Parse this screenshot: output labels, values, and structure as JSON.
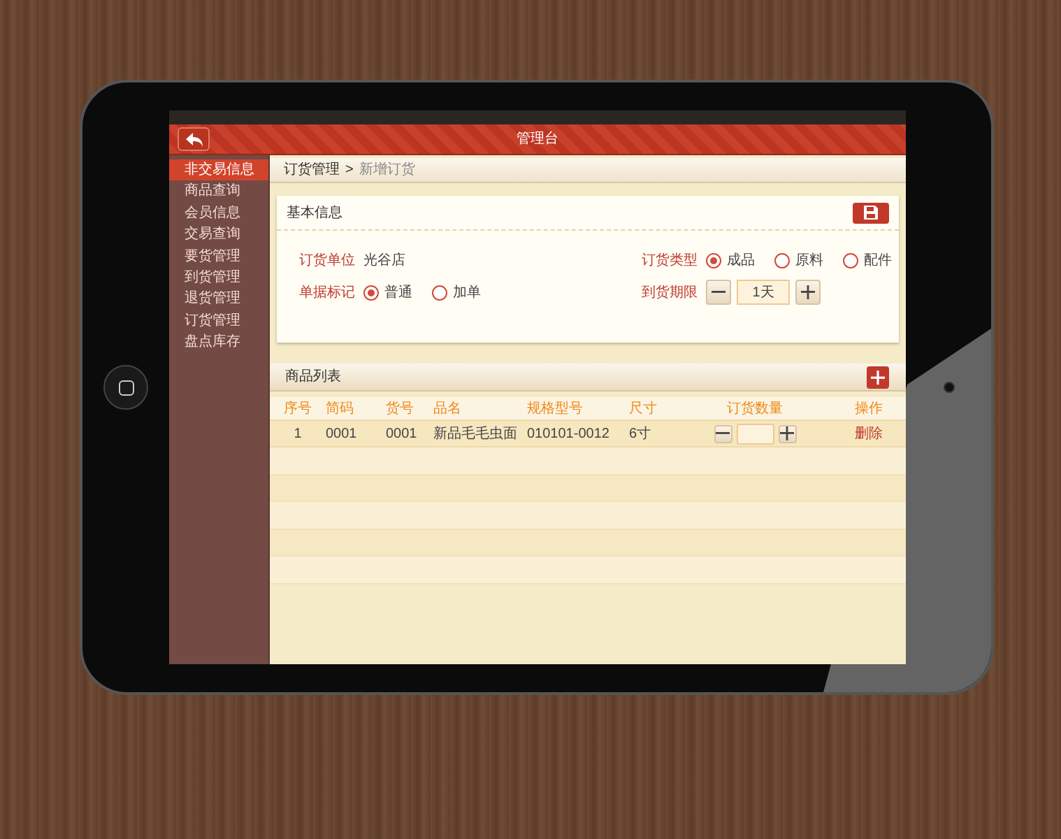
{
  "header": {
    "title": "管理台"
  },
  "sidebar": {
    "items": [
      {
        "label": "非交易信息",
        "selected": true
      },
      {
        "label": "商品查询",
        "selected": false
      },
      {
        "label": "会员信息",
        "selected": false
      },
      {
        "label": "交易查询",
        "selected": false
      },
      {
        "label": "要货管理",
        "selected": false
      },
      {
        "label": "到货管理",
        "selected": false
      },
      {
        "label": "退货管理",
        "selected": false
      },
      {
        "label": "订货管理",
        "selected": false
      },
      {
        "label": "盘点库存",
        "selected": false
      }
    ]
  },
  "breadcrumb": {
    "parent": "订货管理",
    "separator": ">",
    "current": "新增订货"
  },
  "basic_info": {
    "title": "基本信息",
    "fields": [
      {
        "kind": "text",
        "label": "订货单位",
        "value": "光谷店"
      },
      {
        "kind": "radio",
        "label": "订货类型",
        "options": [
          {
            "label": "成品",
            "selected": true
          },
          {
            "label": "原料",
            "selected": false
          },
          {
            "label": "配件",
            "selected": false
          }
        ]
      },
      {
        "kind": "radio",
        "label": "单据标记",
        "options": [
          {
            "label": "普通",
            "selected": true
          },
          {
            "label": "加单",
            "selected": false
          }
        ]
      },
      {
        "kind": "stepper",
        "label": "到货期限",
        "value": "1天"
      }
    ]
  },
  "product_list": {
    "title": "商品列表",
    "columns": [
      "序号",
      "简码",
      "货号",
      "品名",
      "规格型号",
      "尺寸",
      "订货数量",
      "操作"
    ],
    "rows": [
      {
        "cells": [
          "1",
          "0001",
          "0001",
          "新品毛毛虫面",
          "010101-0012",
          "6寸"
        ],
        "action": "删除"
      }
    ]
  }
}
